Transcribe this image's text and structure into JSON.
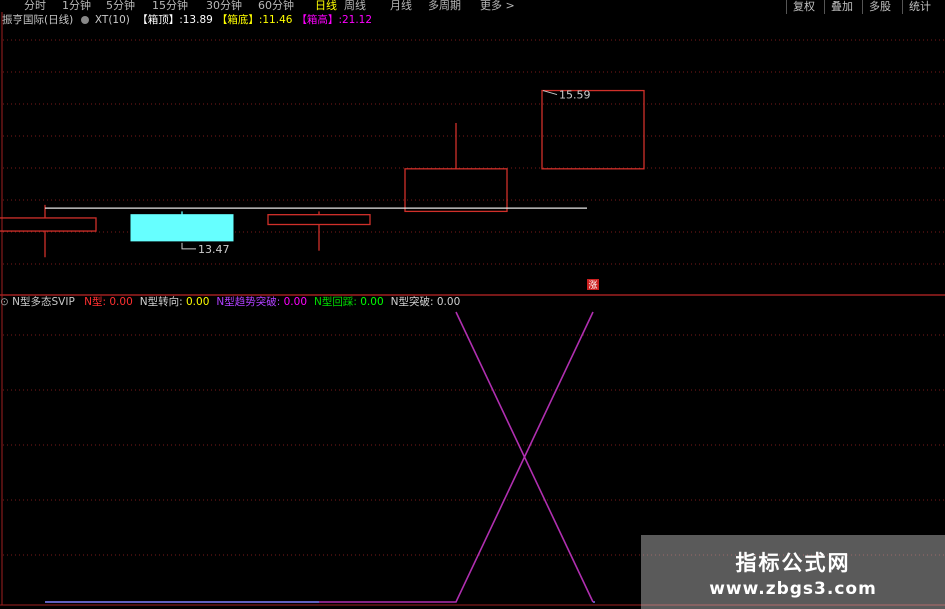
{
  "toolbar": {
    "periods": [
      "分时",
      "1分钟",
      "5分钟",
      "15分钟",
      "30分钟",
      "60分钟",
      "日线",
      "周线",
      "月线",
      "多周期",
      "更多 >"
    ],
    "active_index": 6,
    "right_buttons": [
      "复权",
      "叠加",
      "多股",
      "统计"
    ]
  },
  "main_panel": {
    "title": "振亨国际(日线)",
    "indicator": "XT(10)",
    "items": [
      {
        "label": "【箱顶】",
        "value": ":13.89",
        "color": "#ffffff"
      },
      {
        "label": "【箱底】",
        "value": ":11.46",
        "color": "#ffff00"
      },
      {
        "label": "【箱高】",
        "value": ":21.12",
        "color": "#ff00ff"
      }
    ]
  },
  "colors": {
    "up": "#d0302a",
    "down": "#66ffff",
    "grid": "#7a1a1a",
    "box_line": "#e6e6e6",
    "n_line": "#b02fb0",
    "flat_line": "#8080ff"
  },
  "chart_data": [
    {
      "type": "candlestick",
      "title": "",
      "ylim": [
        9.5,
        17.5
      ],
      "candles": [
        {
          "open": 11.3,
          "high": 12.1,
          "low": 10.5,
          "close": 11.7
        },
        {
          "open": 11.8,
          "high": 11.9,
          "low": 11.0,
          "close": 11.0
        },
        {
          "open": 11.5,
          "high": 11.9,
          "low": 10.7,
          "close": 11.8
        },
        {
          "open": 11.9,
          "high": 14.6,
          "low": 11.9,
          "close": 13.2
        },
        {
          "open": 13.2,
          "high": 15.59,
          "low": 13.2,
          "close": 15.59
        }
      ],
      "hline": {
        "value": 12.0
      },
      "annotations": [
        {
          "text": "13.47"
        },
        {
          "text": "15.59"
        }
      ],
      "marker": "涨"
    },
    {
      "type": "line",
      "title": "N型多态SVIP",
      "legend": [
        {
          "name": "N型:",
          "value": "0.00",
          "color": "#ff3030",
          "label_color": "#ff3030"
        },
        {
          "name": "N型转向:",
          "value": "0.00",
          "color": "#ffff00",
          "label_color": "#d0d0d0"
        },
        {
          "name": "N型趋势突破:",
          "value": "0.00",
          "color": "#ff00ff",
          "label_color": "#b040ff"
        },
        {
          "name": "N型回踩:",
          "value": "0.00",
          "color": "#00ff00",
          "label_color": "#00dd00"
        },
        {
          "name": "N型突破:",
          "value": "0.00",
          "color": "#d0d0d0",
          "label_color": "#d0d0d0"
        }
      ],
      "x": [
        0,
        1,
        2,
        3,
        4,
        5,
        6
      ],
      "series": [
        {
          "values": [
            0,
            0,
            0,
            0,
            1,
            0,
            0
          ]
        }
      ],
      "ylim": [
        0,
        1
      ]
    }
  ],
  "watermark": {
    "line1": "指标公式网",
    "line2": "www.zbgs3.com"
  }
}
